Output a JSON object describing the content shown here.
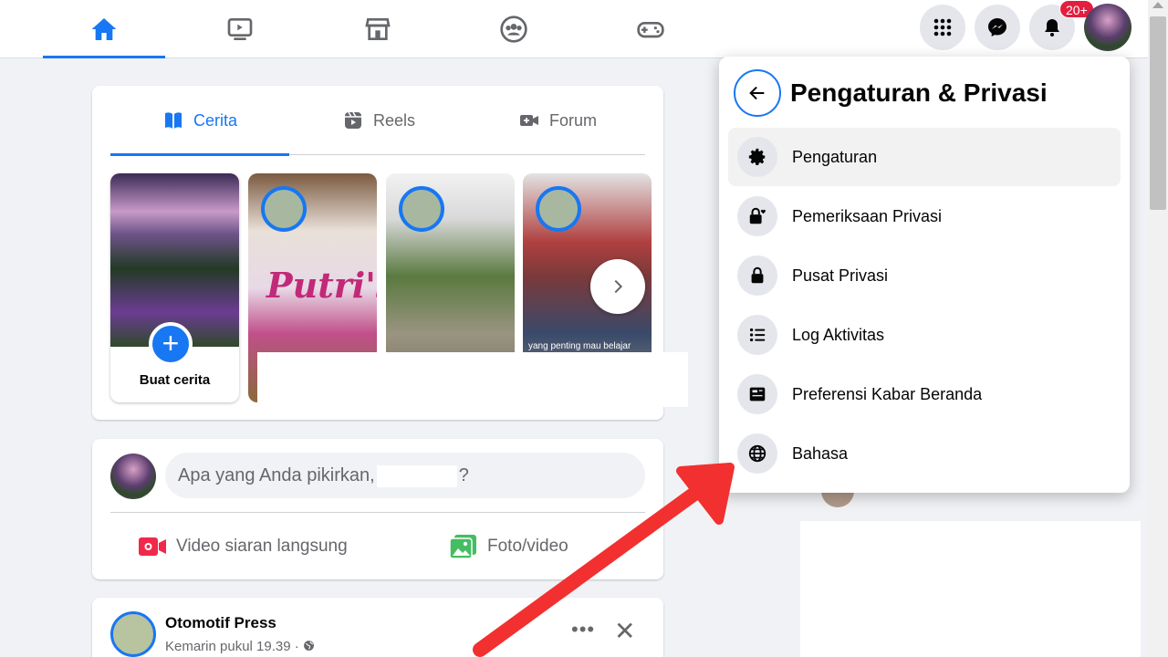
{
  "topnav": {
    "tabs": [
      "home",
      "watch",
      "marketplace",
      "groups",
      "gaming"
    ],
    "notification_badge": "20+"
  },
  "stories_card": {
    "tabs": [
      {
        "label": "Cerita",
        "icon": "book-icon",
        "active": true
      },
      {
        "label": "Reels",
        "icon": "reels-icon",
        "active": false
      },
      {
        "label": "Forum",
        "icon": "video-camera-icon",
        "active": false
      }
    ],
    "create_label": "Buat cerita",
    "story_text_1": "Putri's",
    "story_caption_3": "yang penting mau belajar"
  },
  "composer": {
    "prompt_prefix": "Apa yang Anda pikirkan,",
    "prompt_suffix": "?",
    "actions": [
      {
        "label": "Video siaran langsung",
        "color": "#f02849"
      },
      {
        "label": "Foto/video",
        "color": "#45bd62"
      }
    ]
  },
  "post": {
    "author": "Otomotif Press",
    "meta": "Kemarin pukul 19.39 ·"
  },
  "menu": {
    "title": "Pengaturan & Privasi",
    "items": [
      {
        "label": "Pengaturan",
        "icon": "gear-icon"
      },
      {
        "label": "Pemeriksaan Privasi",
        "icon": "lock-heart-icon"
      },
      {
        "label": "Pusat Privasi",
        "icon": "lock-icon"
      },
      {
        "label": "Log Aktivitas",
        "icon": "list-icon"
      },
      {
        "label": "Preferensi Kabar Beranda",
        "icon": "feed-icon"
      },
      {
        "label": "Bahasa",
        "icon": "globe-icon"
      }
    ]
  },
  "colors": {
    "accent": "#1877f2",
    "annotation_arrow": "#f23030"
  }
}
